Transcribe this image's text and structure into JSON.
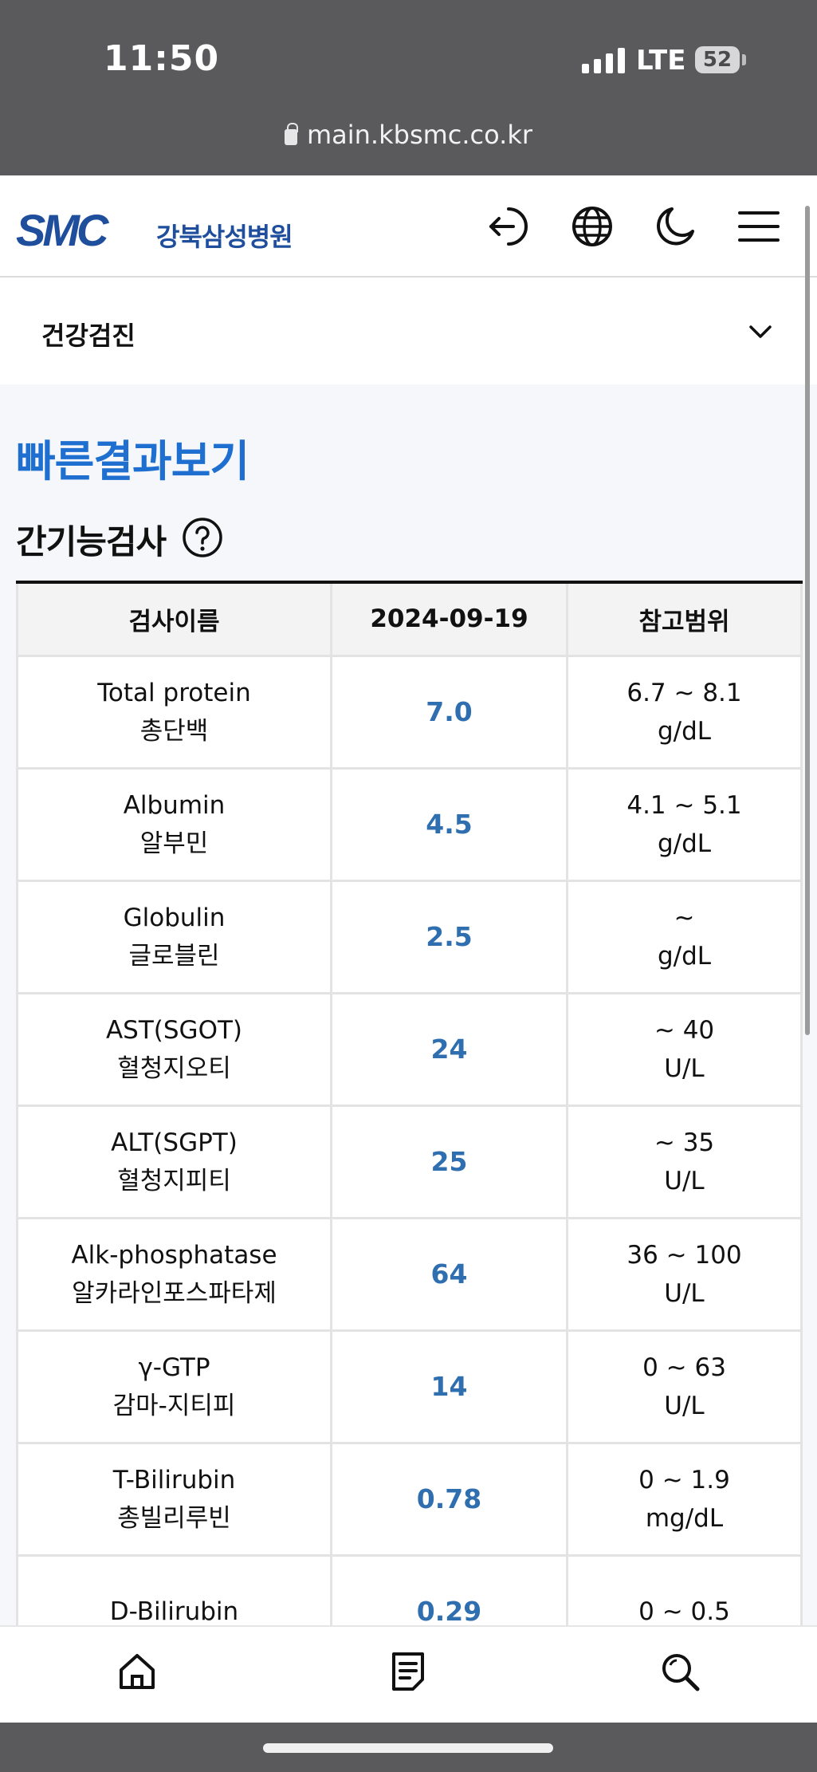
{
  "status_bar": {
    "time": "11:50",
    "network": "LTE",
    "battery": "52"
  },
  "browser": {
    "url": "main.kbsmc.co.kr"
  },
  "header": {
    "logo_mark": "SMC",
    "logo_text": "강북삼성병원"
  },
  "category": {
    "label": "건강검진"
  },
  "page": {
    "title": "빠른결과보기",
    "section_title": "간기능검사"
  },
  "table": {
    "headers": [
      "검사이름",
      "2024-09-19",
      "참고범위"
    ],
    "rows": [
      {
        "name_en": "Total protein",
        "name_ko": "총단백",
        "value": "7.0",
        "range": "6.7 ~ 8.1",
        "unit": "g/dL"
      },
      {
        "name_en": "Albumin",
        "name_ko": "알부민",
        "value": "4.5",
        "range": "4.1 ~ 5.1",
        "unit": "g/dL"
      },
      {
        "name_en": "Globulin",
        "name_ko": "글로블린",
        "value": "2.5",
        "range": "~",
        "unit": "g/dL"
      },
      {
        "name_en": "AST(SGOT)",
        "name_ko": "혈청지오티",
        "value": "24",
        "range": "~ 40",
        "unit": "U/L"
      },
      {
        "name_en": "ALT(SGPT)",
        "name_ko": "혈청지피티",
        "value": "25",
        "range": "~ 35",
        "unit": "U/L"
      },
      {
        "name_en": "Alk-phosphatase",
        "name_ko": "알카라인포스파타제",
        "value": "64",
        "range": "36 ~ 100",
        "unit": "U/L"
      },
      {
        "name_en": "γ-GTP",
        "name_ko": "감마-지티피",
        "value": "14",
        "range": "0 ~ 63",
        "unit": "U/L"
      },
      {
        "name_en": "T-Bilirubin",
        "name_ko": "총빌리루빈",
        "value": "0.78",
        "range": "0 ~ 1.9",
        "unit": "mg/dL"
      },
      {
        "name_en": "D-Bilirubin",
        "name_ko": "",
        "value": "0.29",
        "range": "0 ~ 0.5",
        "unit": ""
      }
    ]
  },
  "tabbar": {
    "items": [
      {
        "icon": "home-icon",
        "label": ""
      },
      {
        "icon": "document-icon",
        "label": ""
      },
      {
        "icon": "search-icon",
        "label": ""
      }
    ]
  },
  "colors": {
    "brand": "#1f4e9c",
    "title_blue": "#1e6fd0",
    "value_blue": "#2f6fb0"
  }
}
